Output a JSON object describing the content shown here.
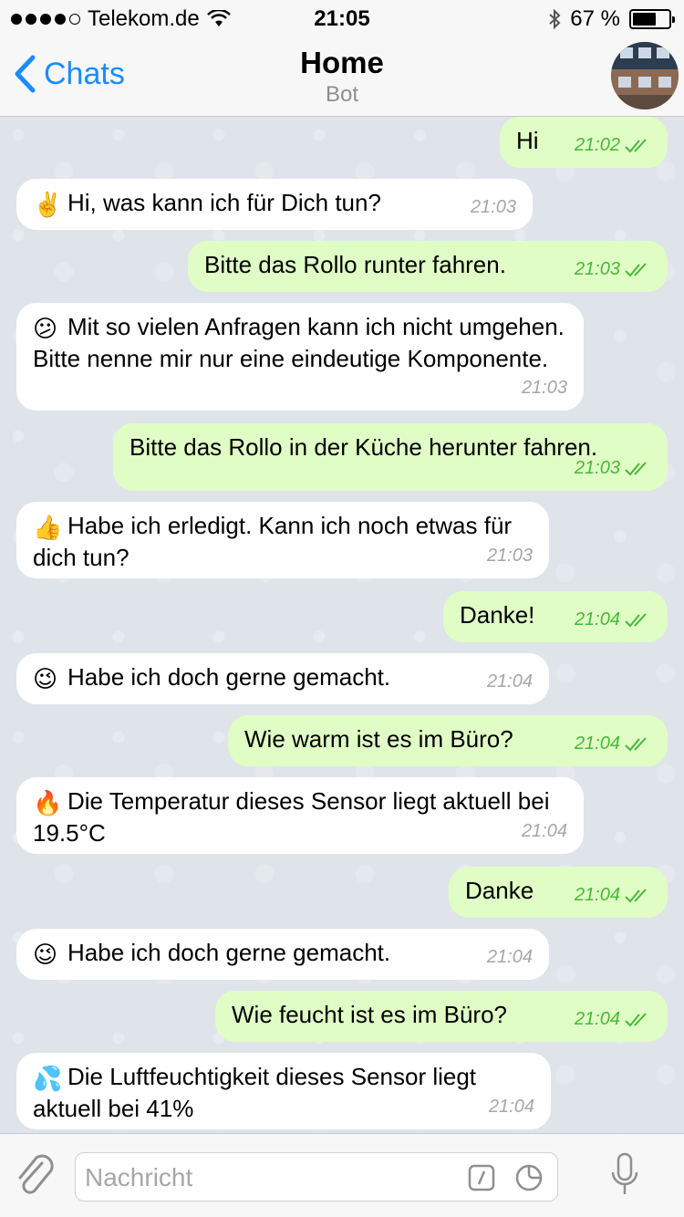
{
  "status_bar": {
    "carrier": "Telekom.de",
    "time": "21:05",
    "battery": "67 %",
    "battery_level": 0.67
  },
  "nav": {
    "back_label": "Chats",
    "title": "Home",
    "subtitle": "Bot"
  },
  "messages": [
    {
      "text": "Hi",
      "time": "21:02"
    },
    {
      "emoji": "✌️",
      "text": "Hi, was kann ich für Dich tun?",
      "time": "21:03"
    },
    {
      "text": "Bitte das Rollo runter fahren.",
      "time": "21:03"
    },
    {
      "emoji": "😕",
      "text": "Mit so vielen Anfragen kann ich nicht umgehen. Bitte nenne mir nur eine eindeutige Komponente.",
      "time": "21:03"
    },
    {
      "text": "Bitte das Rollo in der Küche herunter fahren.",
      "time": "21:03"
    },
    {
      "emoji": "👍",
      "text": "Habe ich erledigt. Kann ich noch etwas für dich tun?",
      "time": "21:03"
    },
    {
      "text": "Danke!",
      "time": "21:04"
    },
    {
      "emoji": "😉",
      "text": "Habe ich doch gerne gemacht.",
      "time": "21:04"
    },
    {
      "text": "Wie warm ist es im Büro?",
      "time": "21:04"
    },
    {
      "emoji": "🔥",
      "text": "Die Temperatur dieses Sensor liegt aktuell bei 19.5°C",
      "time": "21:04"
    },
    {
      "text": "Danke",
      "time": "21:04"
    },
    {
      "emoji": "😉",
      "text": "Habe ich doch gerne gemacht.",
      "time": "21:04"
    },
    {
      "text": "Wie feucht ist es im Büro?",
      "time": "21:04"
    },
    {
      "emoji": "💦",
      "text": "Die Luftfeuchtigkeit dieses Sensor liegt aktuell bei 41%",
      "time": "21:04"
    }
  ],
  "input": {
    "placeholder": "Nachricht"
  },
  "colors": {
    "accent": "#1a8cff",
    "outgoing_bubble": "#e0fdc6",
    "incoming_bubble": "#ffffff",
    "read_check": "#47b838"
  }
}
